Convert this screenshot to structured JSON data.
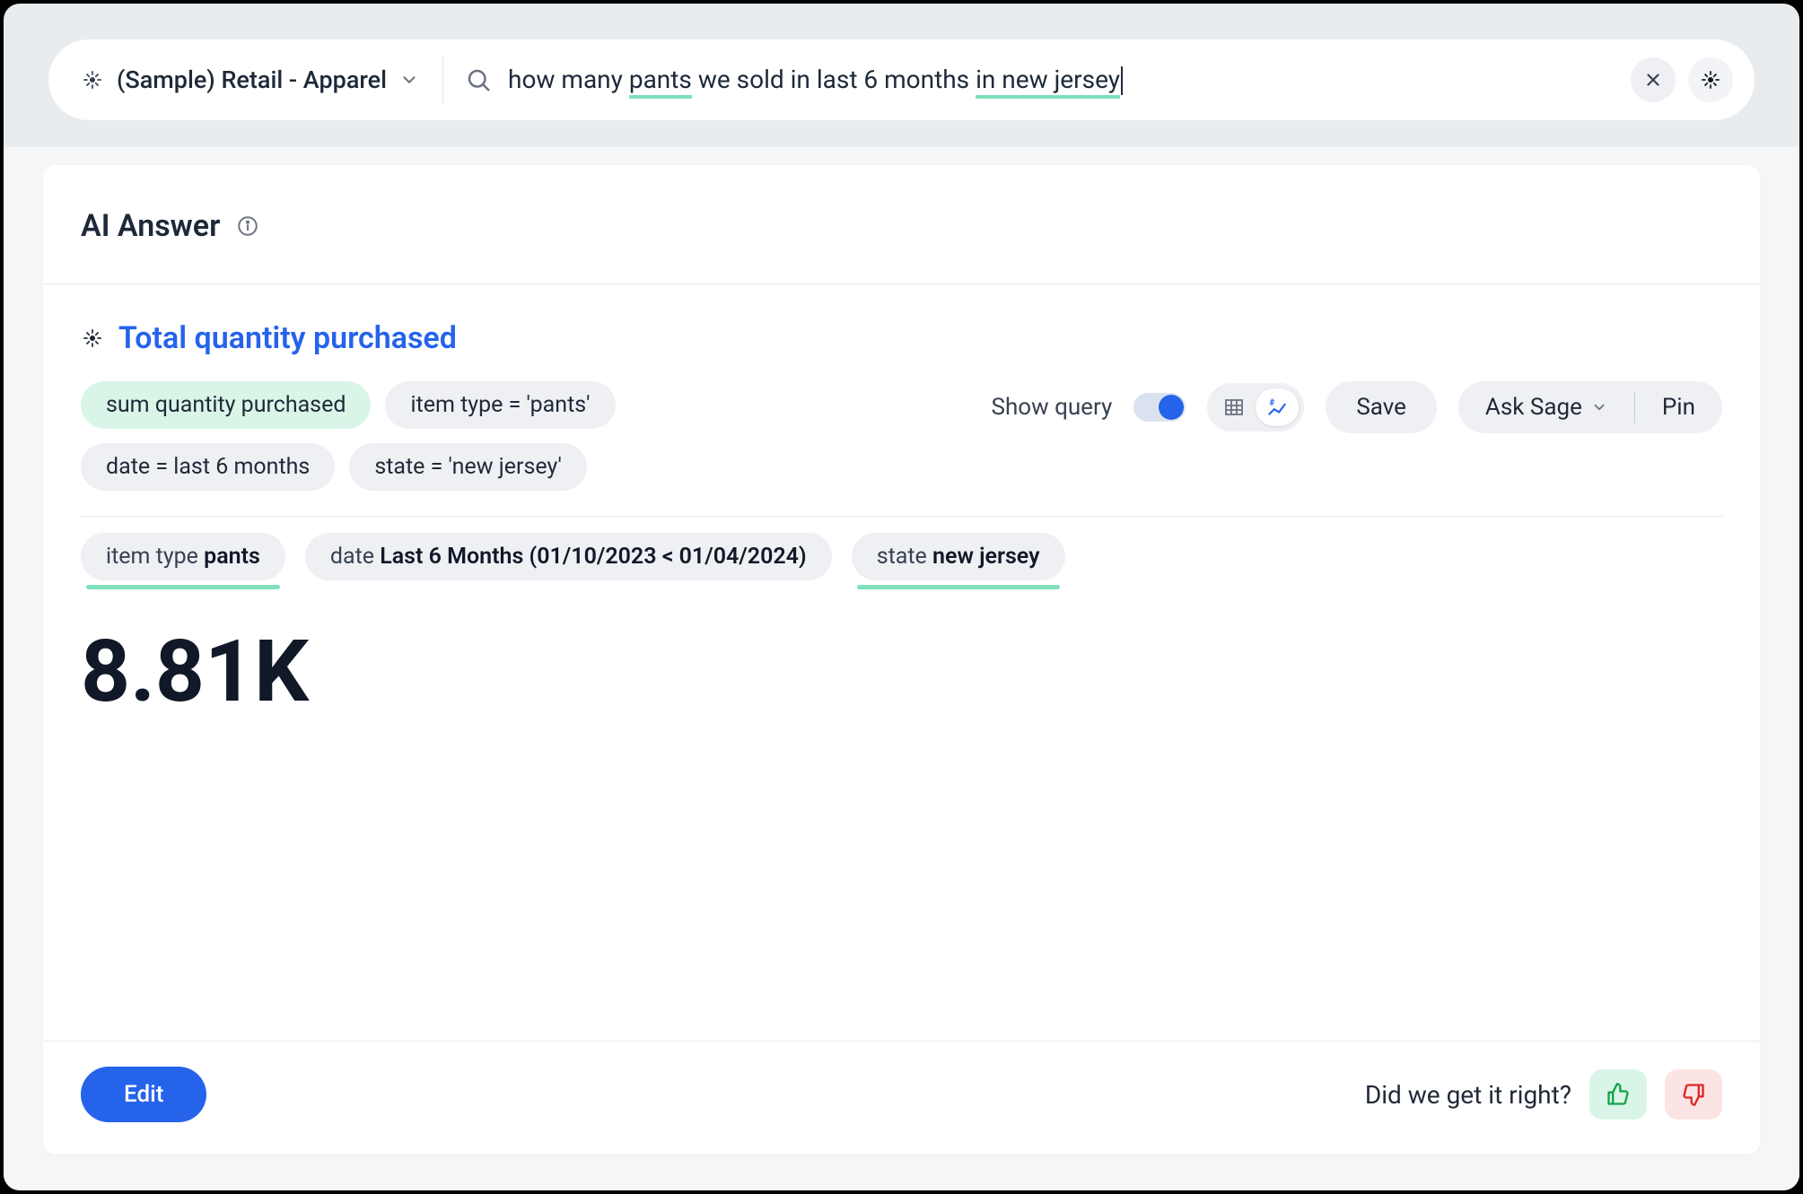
{
  "topbar": {
    "source_label": "(Sample) Retail - Apparel",
    "query_prefix": "how many ",
    "query_term1": "pants",
    "query_mid": " we sold in last 6 months ",
    "query_term2": "in new jersey"
  },
  "card": {
    "header_title": "AI Answer"
  },
  "answer": {
    "title": "Total quantity purchased",
    "query_pills": [
      "sum quantity purchased",
      "item type = 'pants'",
      "date = last 6 months",
      "state = 'new jersey'"
    ],
    "show_query_label": "Show query",
    "save_label": "Save",
    "ask_sage_label": "Ask Sage",
    "pin_label": "Pin",
    "filters": {
      "item_type_label": "item type ",
      "item_type_value": "pants",
      "date_label": "date ",
      "date_value": "Last 6 Months (01/10/2023 < 01/04/2024)",
      "state_label": "state ",
      "state_value": "new jersey"
    },
    "metric": "8.81K"
  },
  "footer": {
    "edit_label": "Edit",
    "feedback_prompt": "Did we get it right?"
  }
}
